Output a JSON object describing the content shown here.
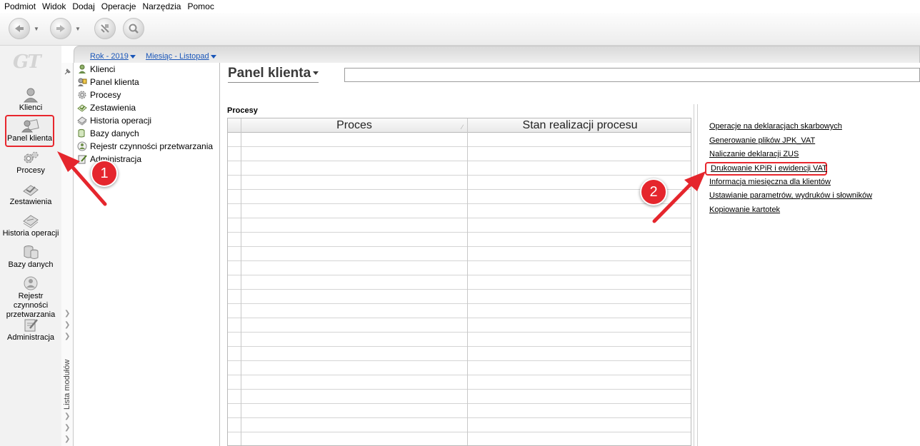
{
  "menu": [
    "Podmiot",
    "Widok",
    "Dodaj",
    "Operacje",
    "Narzędzia",
    "Pomoc"
  ],
  "toolbar": {
    "buttons": [
      "back-icon",
      "forward-icon",
      "refresh-icon",
      "search-icon"
    ]
  },
  "logo": "GT",
  "left_modules": [
    {
      "label": "Klienci",
      "icon": "user-icon",
      "active": false
    },
    {
      "label": "Panel klienta",
      "icon": "client-panel-icon",
      "active": true
    },
    {
      "label": "Procesy",
      "icon": "gears-icon",
      "active": false
    },
    {
      "label": "Zestawienia",
      "icon": "report-icon",
      "active": false
    },
    {
      "label": "Historia operacji",
      "icon": "history-icon",
      "active": false
    },
    {
      "label": "Bazy danych",
      "icon": "database-icon",
      "active": false
    },
    {
      "label": "Rejestr czynności przetwarzania",
      "icon": "registry-icon",
      "active": false
    },
    {
      "label": "Administracja",
      "icon": "admin-icon",
      "active": false
    }
  ],
  "module_strip_label": "Lista modułów",
  "tree": [
    "Klienci",
    "Panel klienta",
    "Procesy",
    "Zestawienia",
    "Historia operacji",
    "Bazy danych",
    "Rejestr czynności przetwarzania",
    "Administracja"
  ],
  "period": {
    "year": "Rok - 2019",
    "month": "Miesiąc - Listopad"
  },
  "panel": {
    "title": "Panel klienta",
    "section": "Procesy",
    "columns": [
      "Proces",
      "Stan realizacji procesu"
    ]
  },
  "links": [
    "Operacje na deklaracjach skarbowych",
    "Generowanie plików JPK_VAT",
    "Naliczanie deklaracji ZUS",
    "Drukowanie KPiR i ewidencji VAT",
    "Informacja miesięczna dla klientów",
    "Ustawianie parametrów, wydruków i słowników",
    "Kopiowanie kartotek"
  ],
  "annotations": {
    "badge_1": "1",
    "badge_2": "2",
    "color": "#e5262d"
  }
}
